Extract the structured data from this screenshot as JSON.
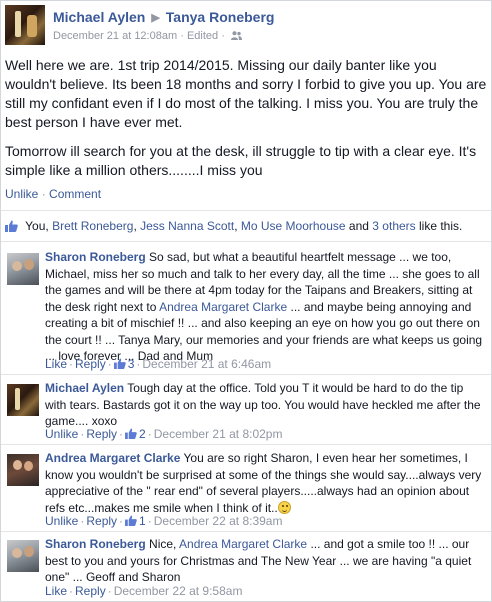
{
  "post": {
    "author": "Michael Aylen",
    "arrow": "▶",
    "target": "Tanya Roneberg",
    "timestamp": "December 21 at 12:08am",
    "meta_sep": "·",
    "edited": "Edited",
    "paragraph_1": "Well here we are. 1st trip 2014/2015. Missing our daily banter like you wouldn't believe. Its been 18 months and sorry I forbid to give you up. You are still my confidant even if I do most of the talking. I miss you. You are truly the best person I have ever met.",
    "paragraph_2": "Tomorrow ill search for you at the desk, ill struggle to tip with a clear eye. It's simple like a million others........I miss you",
    "unlike_label": "Unlike",
    "comment_label": "Comment",
    "action_sep": "·"
  },
  "likes": {
    "you": "You,",
    "name_1": "Brett Roneberg",
    "name_2": "Jess Nanna Scott",
    "name_3": "Mo Use Moorhouse",
    "and": "and",
    "others": "3 others",
    "suffix": "like this."
  },
  "comments": [
    {
      "author": "Sharon Roneberg",
      "text_1": "So sad, but what a beautiful heartfelt message ... we too, Michael, miss her so much and talk to her every day, all the time ... she goes to all the games and will be there at 4pm today for the Taipans and Breakers, sitting at the desk right next to",
      "mention": "Andrea Margaret Clarke",
      "text_2": "... and maybe being annoying and creating a bit of mischief !! ... and also keeping an eye on how you go out there on the court !! ... Tanya Mary, our memories and your friends are what keeps us going ... love forever ... Dad and Mum",
      "action": "Like",
      "reply": "Reply",
      "like_count": "3",
      "timestamp": "December 21 at 6:46am"
    },
    {
      "author": "Michael Aylen",
      "text_1": "Tough day at the office. Told you T it would be hard to do the tip with tears. Bastards got it on the way up too. You would have heckled me after the game.... xoxo",
      "action": "Unlike",
      "reply": "Reply",
      "like_count": "2",
      "timestamp": "December 21 at 8:02pm"
    },
    {
      "author": "Andrea Margaret Clarke",
      "text_1": "You are so right Sharon, I even hear her sometimes, I know you wouldn't be surprised at some of the things she would say....always very appreciative of the \" rear end\" of several players.....always had an opinion about refs etc...makes me smile when I think of it..",
      "action": "Unlike",
      "reply": "Reply",
      "like_count": "1",
      "timestamp": "December 22 at 8:39am"
    },
    {
      "author": "Sharon Roneberg",
      "text_1": "Nice,",
      "mention": "Andrea Margaret Clarke",
      "text_2": "... and got a smile too !! ... our best to you and yours for Christmas and The New Year ... we are having \"a quiet one\" ... Geoff and Sharon",
      "action": "Like",
      "reply": "Reply",
      "timestamp": "December 22 at 9:58am"
    }
  ],
  "colors": {
    "link": "#3b5998",
    "meta": "#9197a3",
    "text": "#141823"
  }
}
